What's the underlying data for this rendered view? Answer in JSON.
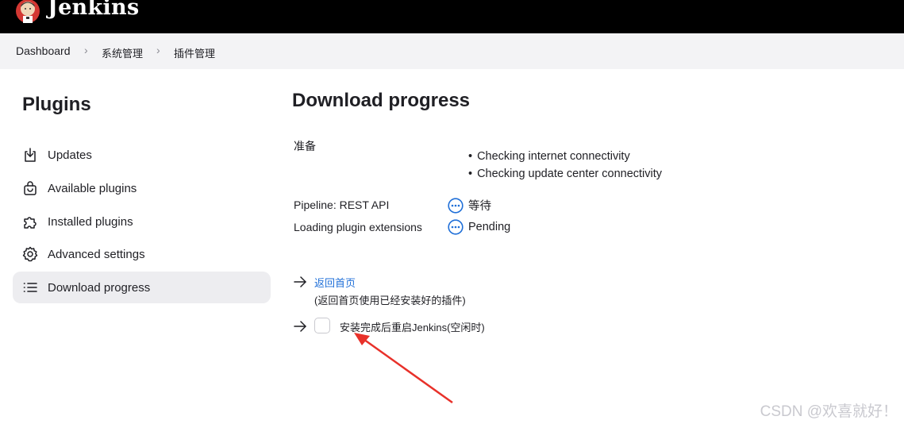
{
  "header": {
    "title": "Jenkins"
  },
  "breadcrumb": {
    "items": [
      "Dashboard",
      "系统管理",
      "插件管理"
    ]
  },
  "sidebar": {
    "title": "Plugins",
    "items": [
      {
        "label": "Updates",
        "icon": "download-icon"
      },
      {
        "label": "Available plugins",
        "icon": "shopping-bag-icon"
      },
      {
        "label": "Installed plugins",
        "icon": "puzzle-icon"
      },
      {
        "label": "Advanced settings",
        "icon": "gear-icon"
      },
      {
        "label": "Download progress",
        "icon": "list-icon",
        "active": true
      }
    ]
  },
  "main": {
    "title": "Download progress",
    "prepare_label": "准备",
    "checks": [
      "Checking internet connectivity",
      "Checking update center connectivity"
    ],
    "rows": [
      {
        "name": "Pipeline: REST API",
        "status": "等待"
      },
      {
        "name": "Loading plugin extensions",
        "status": "Pending"
      }
    ],
    "back_link": "返回首页",
    "back_note": "(返回首页使用已经安装好的插件)",
    "restart_label": "安装完成后重启Jenkins(空闲时)"
  },
  "watermark": "CSDN @欢喜就好！",
  "colors": {
    "link": "#1f6fd8",
    "status_icon": "#1f6fd8",
    "annotation_arrow": "#e8312a"
  }
}
